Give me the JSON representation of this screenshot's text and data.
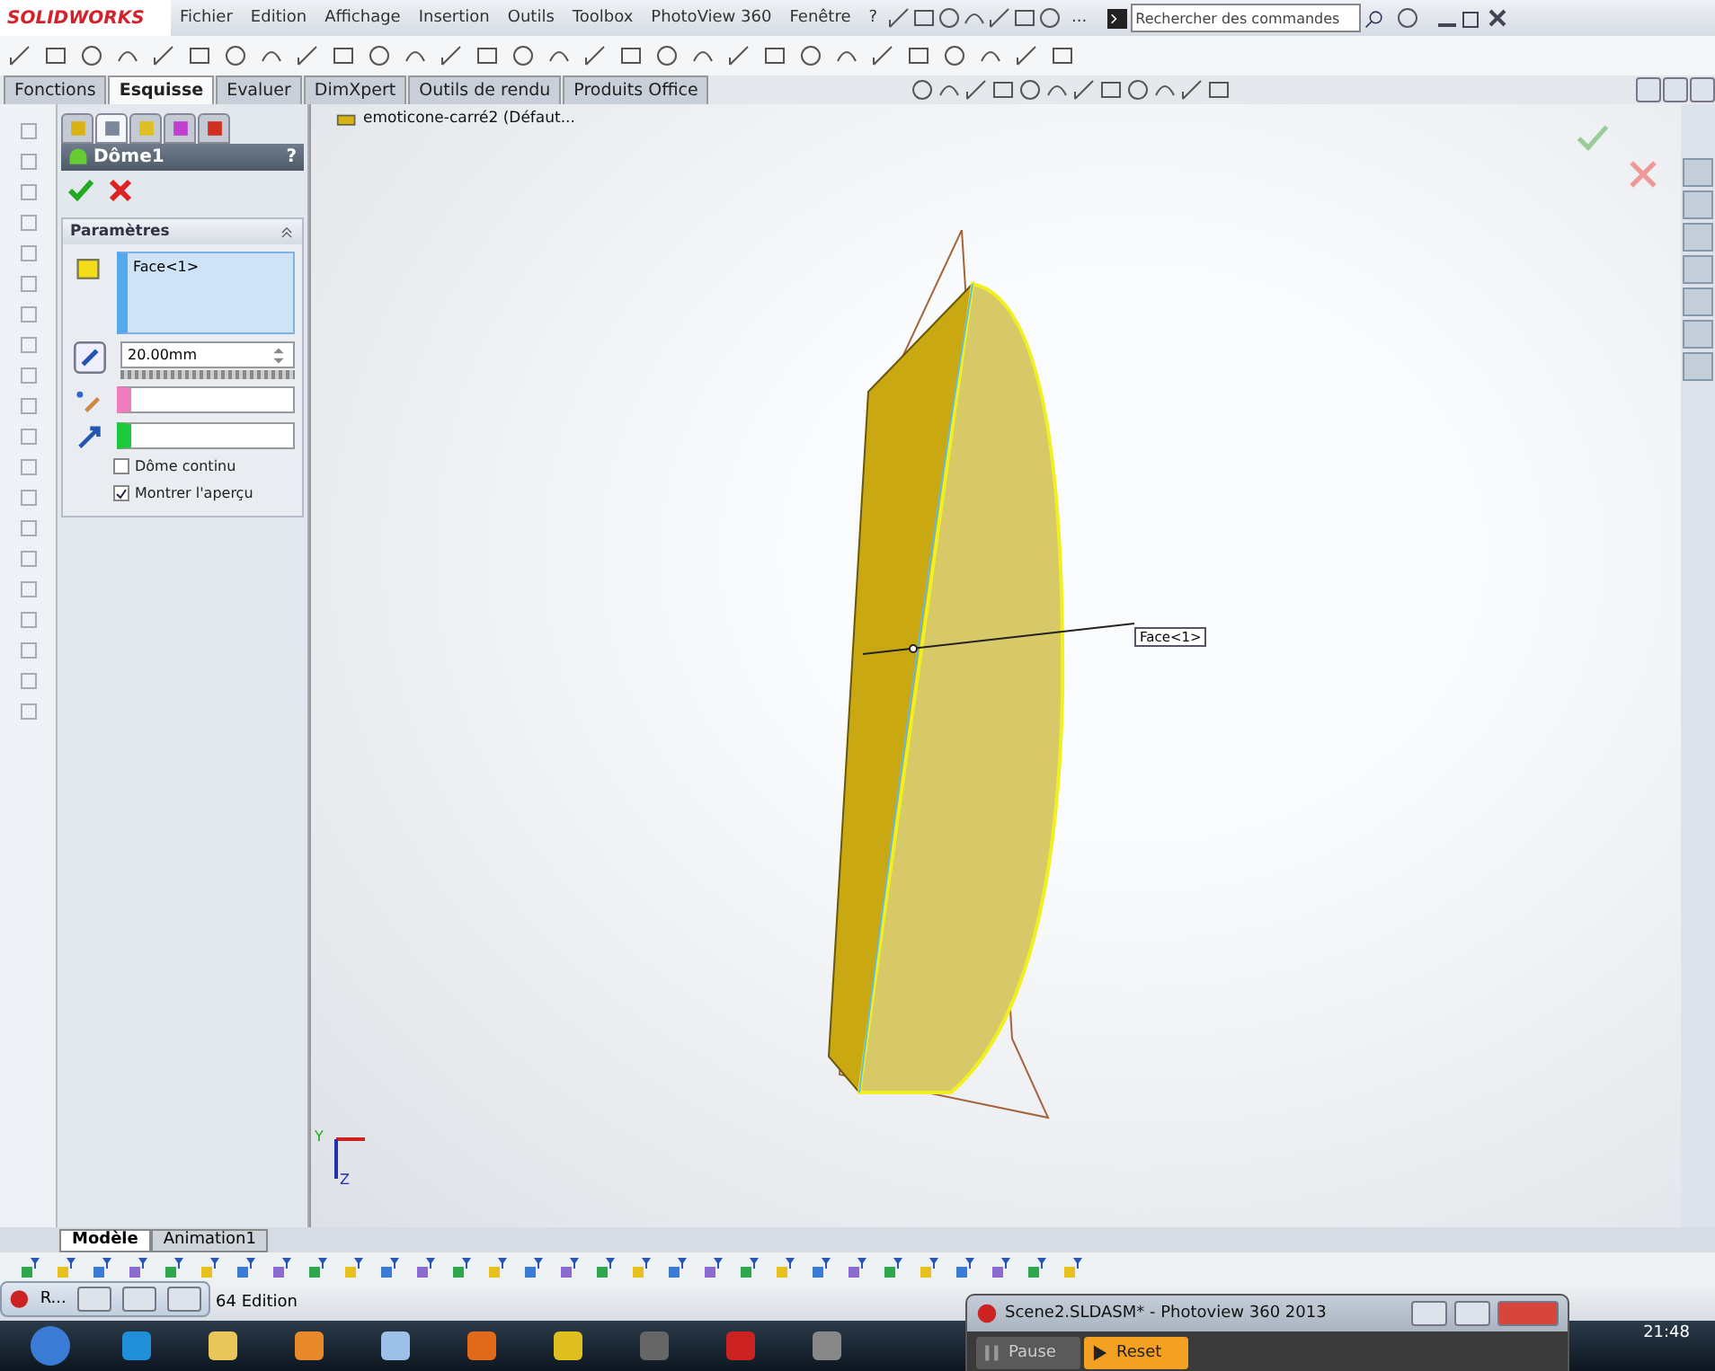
{
  "app": {
    "logo": "SOLIDWORKS",
    "menu": [
      "Fichier",
      "Edition",
      "Affichage",
      "Insertion",
      "Outils",
      "Toolbox",
      "PhotoView 360",
      "Fenêtre",
      "?"
    ],
    "overflow": "...",
    "search": {
      "placeholder": "Rechercher des commandes"
    }
  },
  "command_tabs": [
    {
      "label": "Fonctions",
      "selected": false
    },
    {
      "label": "Esquisse",
      "selected": true
    },
    {
      "label": "Evaluer",
      "selected": false
    },
    {
      "label": "DimXpert",
      "selected": false
    },
    {
      "label": "Outils de rendu",
      "selected": false
    },
    {
      "label": "Produits Office",
      "selected": false
    }
  ],
  "property_manager": {
    "icon_tabs": [
      {
        "selected": false
      },
      {
        "selected": true
      },
      {
        "selected": false
      },
      {
        "selected": false
      },
      {
        "selected": false
      }
    ],
    "title": "Dôme1",
    "help": "?",
    "section": "Paramètres",
    "selection": {
      "value": "Face<1>",
      "color": "#55a8ee"
    },
    "distance": "20.00mm",
    "swatch_fields": [
      {
        "color": "#f07cc0"
      },
      {
        "color": "#1ec83c"
      }
    ],
    "options": [
      {
        "label": "Dôme continu",
        "checked": false
      },
      {
        "label": "Montrer l'aperçu",
        "checked": true
      }
    ]
  },
  "viewport": {
    "tree_item": "emoticone-carré2  (Défaut...",
    "callout": "Face<1>",
    "axis_labels": [
      "Y",
      "Z"
    ]
  },
  "bottom_tabs": [
    {
      "label": "Modèle",
      "selected": true
    },
    {
      "label": "Animation1",
      "selected": false
    }
  ],
  "status_bar": {
    "text": "64 Edition"
  },
  "minimized_window": {
    "title": "R..."
  },
  "photoview_window": {
    "title": "Scene2.SLDASM* - Photoview 360 2013",
    "buttons": [
      {
        "label": "Pause",
        "selected": false
      },
      {
        "label": "Reset",
        "selected": true
      }
    ]
  },
  "taskbar": {
    "clock": "21:48"
  }
}
